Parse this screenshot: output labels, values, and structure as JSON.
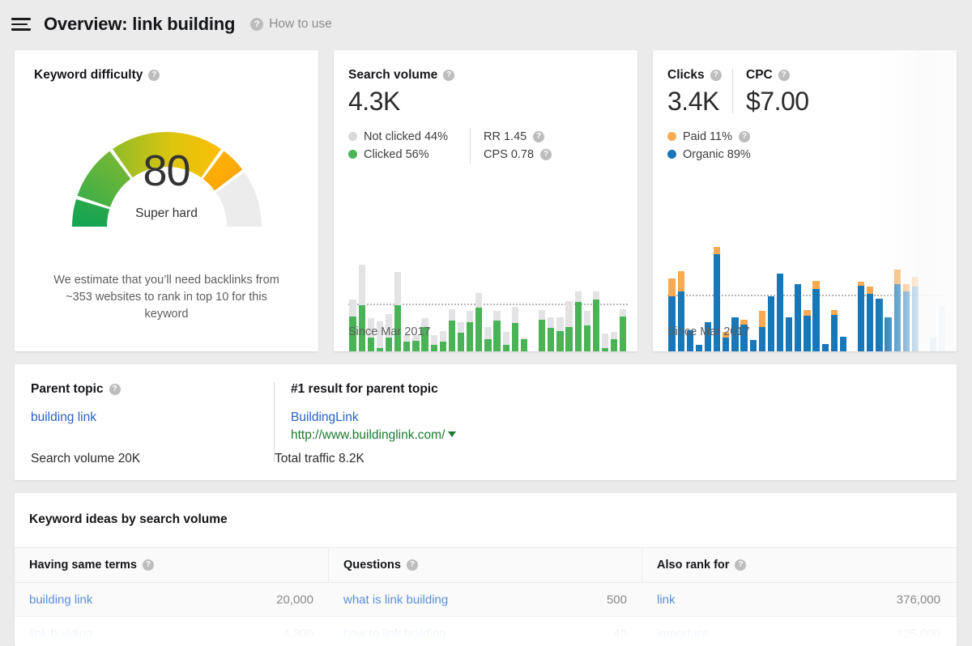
{
  "header": {
    "menu_icon": "hamburger-menu-icon",
    "title": "Overview: link building",
    "help_icon": "help-circle-icon",
    "how_to_use": "How to use"
  },
  "keyword_difficulty": {
    "title": "Keyword difficulty",
    "help_icon": "help-circle-icon",
    "score": "80",
    "label": "Super hard",
    "note_line1": "We estimate that you’ll need backlinks from",
    "note_line2": "~353 websites to rank in top 10 for this keyword",
    "gauge": {
      "value": 80,
      "max": 100,
      "segments": [
        {
          "from": 0,
          "to": 10,
          "color_start": "#13a453",
          "color_end": "#29a84c"
        },
        {
          "from": 10,
          "to": 30,
          "color_start": "#3aae4b",
          "color_end": "#78b833"
        },
        {
          "from": 30,
          "to": 70,
          "color_start": "#8cbd2a",
          "color_end": "#fbbe07"
        },
        {
          "from": 70,
          "to": 80,
          "color_start": "#fcb006",
          "color_end": "#fca108"
        },
        {
          "from": 80,
          "to": 100,
          "color_start": "#ececec",
          "color_end": "#ececec"
        }
      ],
      "track_color": "#ececec"
    }
  },
  "search_volume": {
    "title": "Search volume",
    "help_icon": "help-circle-icon",
    "value": "4.3K",
    "legend": [
      {
        "label": "Not clicked 44%",
        "color": "#d9d9d9",
        "dot": "legend-dot-not-clicked"
      },
      {
        "label": "Clicked 56%",
        "color": "#49b356",
        "dot": "legend-dot-clicked"
      }
    ],
    "stats": [
      {
        "label": "RR 1.45",
        "help_icon": "help-circle-icon"
      },
      {
        "label": "CPS 0.78",
        "help_icon": "help-circle-icon"
      }
    ],
    "since": "Since Mar 2017"
  },
  "clicks": {
    "title": "Clicks",
    "help_icon": "help-circle-icon",
    "value": "3.4K",
    "cpc_title": "CPC",
    "cpc_help_icon": "help-circle-icon",
    "cpc_value": "$7.00",
    "legend": [
      {
        "label": "Paid 11%",
        "color": "#f9a94f",
        "dot": "legend-dot-paid",
        "help_icon": "help-circle-icon"
      },
      {
        "label": "Organic 89%",
        "color": "#1777b8",
        "dot": "legend-dot-organic"
      }
    ],
    "since": "Since Mar 2017"
  },
  "parent_topic": {
    "title": "Parent topic",
    "help_icon": "help-circle-icon",
    "keyword": "building link",
    "search_volume": "Search volume 20K",
    "result_title": "#1 result for parent topic",
    "result_name": "BuildingLink",
    "result_url": "http://www.buildinglink.com/",
    "url_caret_icon": "caret-down-icon",
    "total_traffic": "Total traffic 8.2K"
  },
  "keyword_ideas": {
    "title": "Keyword ideas by search volume",
    "columns": [
      {
        "label": "Having same terms",
        "help_icon": "help-circle-icon"
      },
      {
        "label": "Questions",
        "help_icon": "help-circle-icon"
      },
      {
        "label": "Also rank for",
        "help_icon": "help-circle-icon"
      }
    ],
    "rows": [
      {
        "same_terms": "building link",
        "same_terms_vol": "20,000",
        "questions": "what is link building",
        "questions_vol": "500",
        "also_rank": "link",
        "also_rank_vol": "376,000"
      },
      {
        "same_terms": "link building",
        "same_terms_vol": "4,300",
        "questions": "how to link building",
        "questions_vol": "40",
        "also_rank": "important",
        "also_rank_vol": "125,000"
      }
    ]
  },
  "chart_data": [
    {
      "type": "bar",
      "id": "search-volume-chart",
      "title": "Search volume",
      "stacked": true,
      "xlabel": "Since Mar 2017",
      "ylabel": "",
      "legend": [
        "Clicked",
        "Not clicked"
      ],
      "colors": {
        "clicked": "#49b356",
        "not_clicked": "#e3e3e5"
      },
      "average_line": 56,
      "ylim": [
        0,
        100
      ],
      "series": [
        {
          "name": "clicked",
          "values": [
            44,
            56,
            22,
            11,
            22,
            56,
            18,
            19,
            33,
            14,
            18,
            40,
            27,
            38,
            53,
            20,
            40,
            14,
            37,
            20,
            3,
            41,
            32,
            29,
            33,
            59,
            35,
            62,
            11,
            20,
            44
          ]
        },
        {
          "name": "not_clicked",
          "values": [
            18,
            42,
            20,
            28,
            25,
            35,
            7,
            6,
            9,
            11,
            11,
            12,
            11,
            12,
            16,
            13,
            10,
            14,
            17,
            2,
            1,
            10,
            11,
            14,
            27,
            11,
            15,
            8,
            15,
            8,
            8
          ]
        }
      ]
    },
    {
      "type": "bar",
      "id": "clicks-chart",
      "title": "Clicks",
      "stacked": true,
      "xlabel": "Since Mar 2017",
      "ylabel": "",
      "legend": [
        "Organic",
        "Paid"
      ],
      "colors": {
        "organic": "#1777b8",
        "paid": "#f9a94f"
      },
      "average_line": 52,
      "ylim": [
        0,
        100
      ],
      "series": [
        {
          "name": "organic",
          "values": [
            52,
            56,
            24,
            12,
            31,
            87,
            18,
            35,
            29,
            16,
            27,
            52,
            71,
            35,
            62,
            36,
            58,
            13,
            37,
            19,
            3,
            61,
            54,
            50,
            35,
            62,
            56,
            60,
            4,
            18,
            44
          ]
        },
        {
          "name": "paid",
          "values": [
            15,
            17,
            0,
            0,
            0,
            6,
            5,
            0,
            4,
            0,
            13,
            0,
            0,
            0,
            0,
            5,
            7,
            0,
            4,
            0,
            0,
            3,
            6,
            0,
            0,
            12,
            6,
            8,
            0,
            0,
            0
          ]
        }
      ],
      "faded_from_index": 26
    }
  ]
}
